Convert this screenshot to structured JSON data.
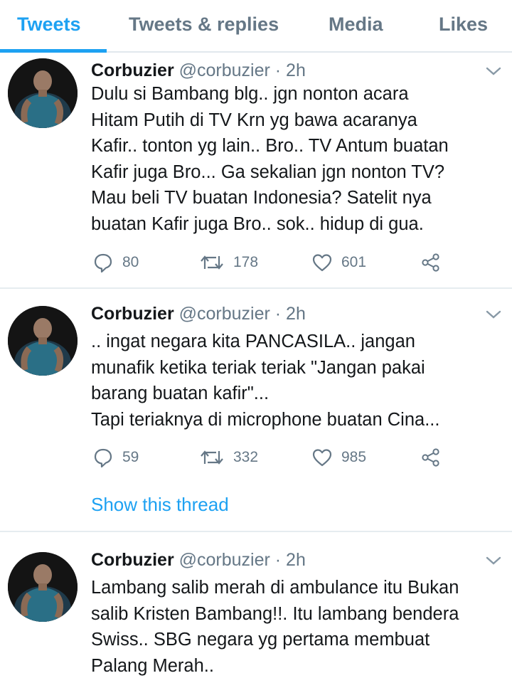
{
  "tabs": [
    {
      "label": "Tweets",
      "active": true
    },
    {
      "label": "Tweets & replies",
      "active": false
    },
    {
      "label": "Media",
      "active": false
    },
    {
      "label": "Likes",
      "active": false
    }
  ],
  "colors": {
    "accent": "#1da1f2",
    "secondary_text": "#657786",
    "primary_text": "#14171a",
    "divider": "#e6ecf0"
  },
  "icons": {
    "reply": "speech-bubble-icon",
    "retweet": "retweet-arrows-icon",
    "like": "heart-icon",
    "share": "share-nodes-icon",
    "menu": "chevron-down-icon"
  },
  "tweets": [
    {
      "name": "Corbuzier",
      "handle": "@corbuzier",
      "time": " · 2h",
      "lines": [
        "Dulu si Bambang blg.. jgn nonton acara",
        "Hitam Putih di TV Krn yg bawa acaranya",
        "Kafir.. tonton yg lain.. Bro.. TV Antum buatan",
        "Kafir juga Bro... Ga sekalian jgn nonton TV?",
        "Mau beli TV buatan Indonesia? Satelit nya",
        "buatan Kafir juga Bro.. sok.. hidup di gua."
      ],
      "replies": "80",
      "retweets": "178",
      "likes": "601"
    },
    {
      "name": "Corbuzier",
      "handle": "@corbuzier",
      "time": " · 2h",
      "lines": [
        ".. ingat negara kita PANCASILA.. jangan",
        "munafik ketika teriak teriak  \"Jangan pakai",
        "barang buatan kafir\"...",
        "Tapi teriaknya di microphone buatan Cina..."
      ],
      "replies": "59",
      "retweets": "332",
      "likes": "985",
      "show_thread": "Show this thread"
    },
    {
      "name": "Corbuzier",
      "handle": "@corbuzier",
      "time": " · 2h",
      "lines": [
        "Lambang salib merah di ambulance itu Bukan",
        "salib Kristen Bambang!!. Itu lambang bendera",
        "Swiss.. SBG negara yg pertama membuat",
        "Palang Merah.."
      ]
    }
  ]
}
